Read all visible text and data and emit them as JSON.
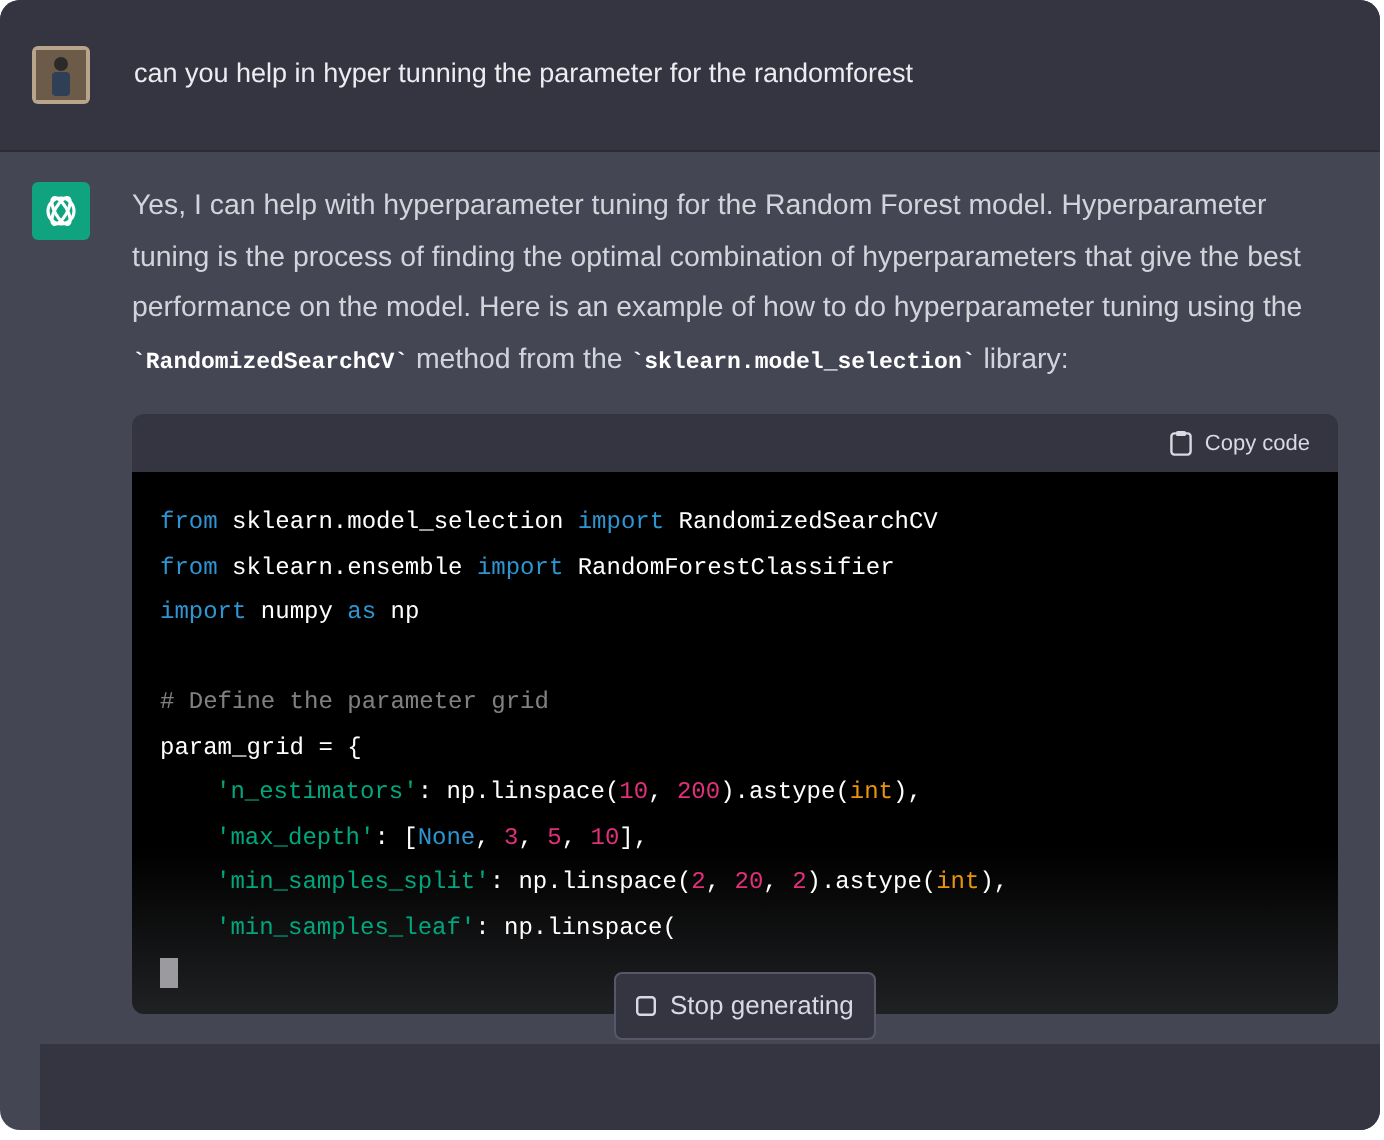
{
  "user_message": {
    "text": "can you help in hyper tunning the parameter for the randomforest"
  },
  "assistant_message": {
    "paragraph": [
      {
        "kind": "text",
        "text": "Yes, I can help with hyperparameter tuning for the Random Forest model. Hyperparameter tuning is the process of finding the optimal combination of hyperparameters that give the best performance on the model. Here is an example of how to do hyperparameter tuning using the "
      },
      {
        "kind": "code",
        "text": "`RandomizedSearchCV`"
      },
      {
        "kind": "text",
        "text": " method from the "
      },
      {
        "kind": "code",
        "text": "`sklearn.model_selection`"
      },
      {
        "kind": "text",
        "text": " library:"
      }
    ],
    "code_block": {
      "copy_label": "Copy code",
      "lines": [
        {
          "kind": "code",
          "indent": false,
          "tokens": [
            {
              "kind": "kw",
              "text": "from"
            },
            {
              "kind": "plain",
              "text": " sklearn.model_selection "
            },
            {
              "kind": "kw",
              "text": "import"
            },
            {
              "kind": "plain",
              "text": " RandomizedSearchCV"
            }
          ]
        },
        {
          "kind": "code",
          "indent": false,
          "tokens": [
            {
              "kind": "kw",
              "text": "from"
            },
            {
              "kind": "plain",
              "text": " sklearn.ensemble "
            },
            {
              "kind": "kw",
              "text": "import"
            },
            {
              "kind": "plain",
              "text": " RandomForestClassifier"
            }
          ]
        },
        {
          "kind": "code",
          "indent": false,
          "tokens": [
            {
              "kind": "kw",
              "text": "import"
            },
            {
              "kind": "plain",
              "text": " numpy "
            },
            {
              "kind": "kw",
              "text": "as"
            },
            {
              "kind": "plain",
              "text": " np"
            }
          ]
        },
        {
          "kind": "blank"
        },
        {
          "kind": "code",
          "indent": false,
          "tokens": [
            {
              "kind": "comment",
              "text": "# Define the parameter grid"
            }
          ]
        },
        {
          "kind": "code",
          "indent": false,
          "tokens": [
            {
              "kind": "plain",
              "text": "param_grid = {"
            }
          ]
        },
        {
          "kind": "code",
          "indent": true,
          "tokens": [
            {
              "kind": "str",
              "text": "'n_estimators'"
            },
            {
              "kind": "plain",
              "text": ": np.linspace("
            },
            {
              "kind": "num",
              "text": "10"
            },
            {
              "kind": "plain",
              "text": ", "
            },
            {
              "kind": "num",
              "text": "200"
            },
            {
              "kind": "plain",
              "text": ").astype("
            },
            {
              "kind": "builtin",
              "text": "int"
            },
            {
              "kind": "plain",
              "text": "),"
            }
          ]
        },
        {
          "kind": "code",
          "indent": true,
          "tokens": [
            {
              "kind": "str",
              "text": "'max_depth'"
            },
            {
              "kind": "plain",
              "text": ": ["
            },
            {
              "kind": "const",
              "text": "None"
            },
            {
              "kind": "plain",
              "text": ", "
            },
            {
              "kind": "num",
              "text": "3"
            },
            {
              "kind": "plain",
              "text": ", "
            },
            {
              "kind": "num",
              "text": "5"
            },
            {
              "kind": "plain",
              "text": ", "
            },
            {
              "kind": "num",
              "text": "10"
            },
            {
              "kind": "plain",
              "text": "],"
            }
          ]
        },
        {
          "kind": "code",
          "indent": true,
          "tokens": [
            {
              "kind": "str",
              "text": "'min_samples_split'"
            },
            {
              "kind": "plain",
              "text": ": np.linspace("
            },
            {
              "kind": "num",
              "text": "2"
            },
            {
              "kind": "plain",
              "text": ", "
            },
            {
              "kind": "num",
              "text": "20"
            },
            {
              "kind": "plain",
              "text": ", "
            },
            {
              "kind": "num",
              "text": "2"
            },
            {
              "kind": "plain",
              "text": ").astype("
            },
            {
              "kind": "builtin",
              "text": "int"
            },
            {
              "kind": "plain",
              "text": "),"
            }
          ]
        },
        {
          "kind": "code",
          "indent": true,
          "tokens": [
            {
              "kind": "str",
              "text": "'min_samples_leaf'"
            },
            {
              "kind": "plain",
              "text": ": np.linspace("
            }
          ]
        }
      ]
    }
  },
  "stop_button": {
    "label": "Stop generating"
  }
}
